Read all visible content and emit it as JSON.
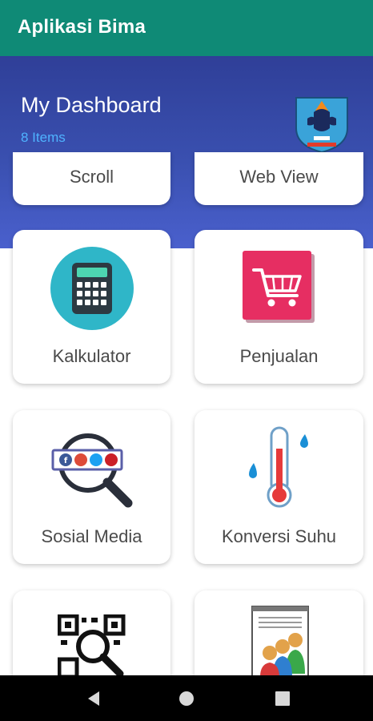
{
  "app": {
    "title": "Aplikasi Bima"
  },
  "dashboard": {
    "title": "My Dashboard",
    "count_label": "8 Items"
  },
  "cards": [
    {
      "label": "Scroll"
    },
    {
      "label": "Web View"
    },
    {
      "label": "Kalkulator",
      "icon": "calculator-icon"
    },
    {
      "label": "Penjualan",
      "icon": "shopping-cart-icon"
    },
    {
      "label": "Sosial Media",
      "icon": "social-media-search-icon"
    },
    {
      "label": "Konversi Suhu",
      "icon": "thermometer-icon"
    },
    {
      "label": "",
      "icon": "qr-code-scan-icon"
    },
    {
      "label": "",
      "icon": "users-document-icon"
    }
  ],
  "colors": {
    "appbar": "#0f8a76",
    "hero_top": "#2f3f98",
    "hero_bottom": "#4a60cd",
    "count_label": "#4fb3ff"
  },
  "navbar": {
    "back_icon": "back-triangle-icon",
    "home_icon": "home-circle-icon",
    "recents_icon": "recents-square-icon"
  }
}
